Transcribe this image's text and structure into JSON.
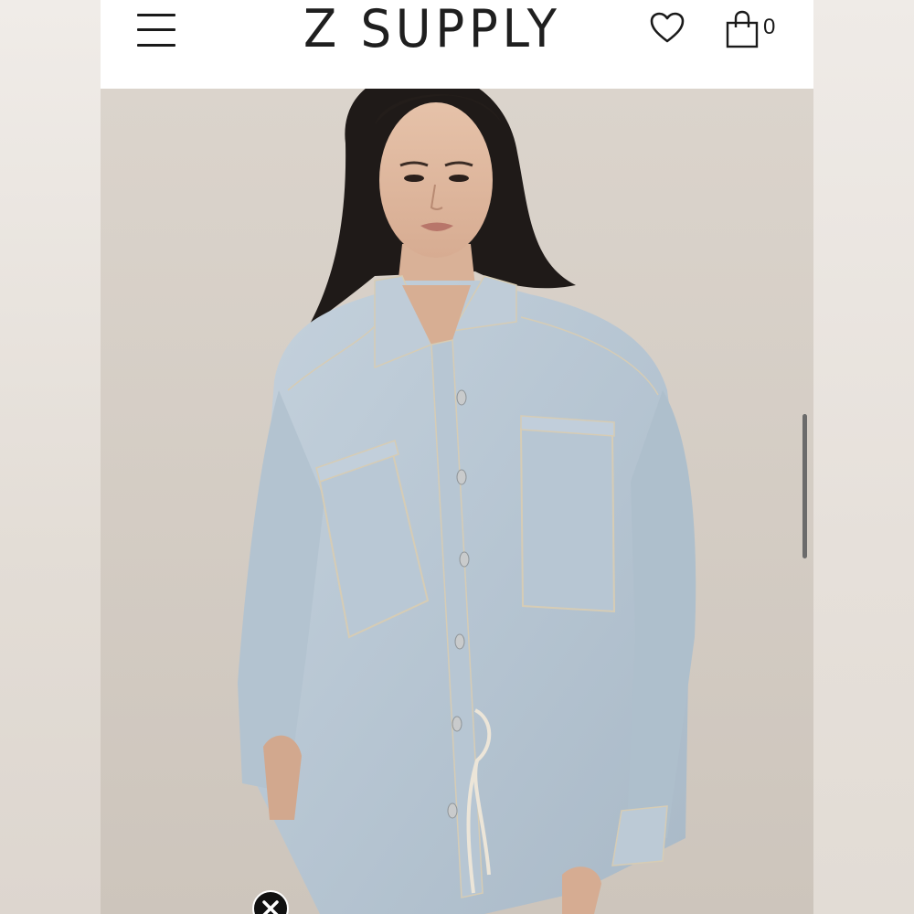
{
  "header": {
    "brand": "Z SUPPLY",
    "menu_icon": "hamburger-menu-icon",
    "wishlist_icon": "heart-icon",
    "cart_icon": "shopping-bag-icon",
    "cart_count": "0"
  },
  "hero": {
    "image": "model-wearing-light-denim-shirt-jacket",
    "colors": {
      "background": "#d6cec6",
      "denim": "#b9c8d4",
      "stitching": "#d9cdb4"
    }
  },
  "overlay": {
    "close_icon": "close-icon"
  }
}
